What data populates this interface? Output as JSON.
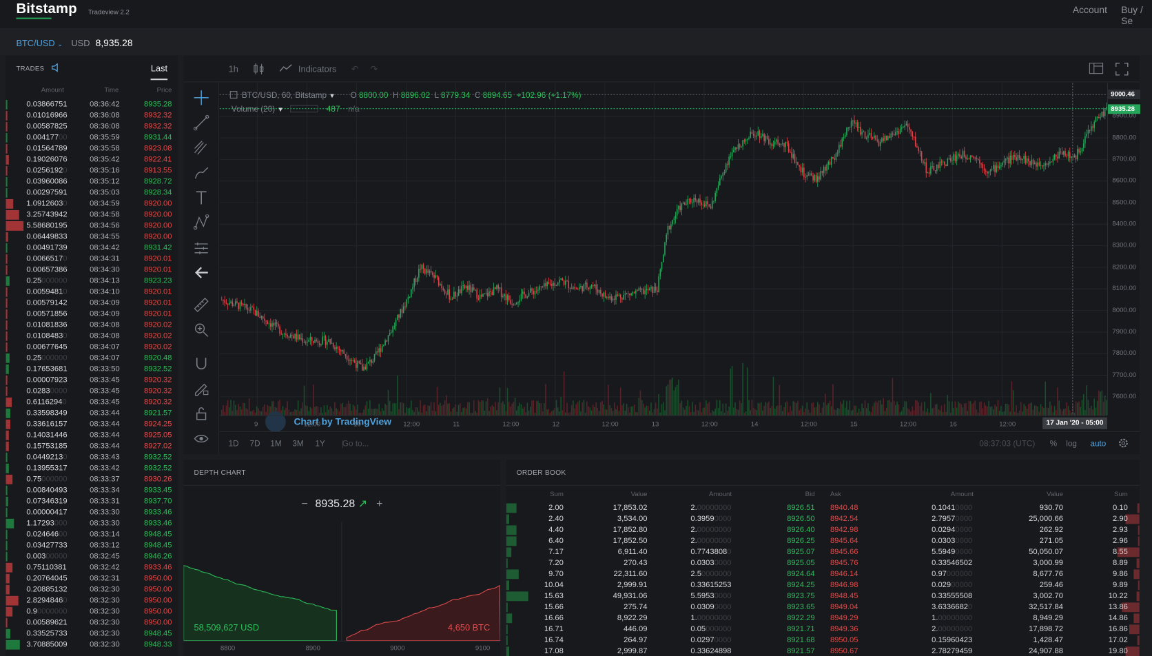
{
  "header": {
    "logo": "Bitstamp",
    "version": "Tradeview 2.2",
    "nav": [
      "Account",
      "Buy / Se"
    ]
  },
  "pair": {
    "name": "BTC/USD",
    "currency": "USD",
    "price": "8,935.28"
  },
  "trades": {
    "title": "TRADES",
    "tab": "Last",
    "columns": [
      "Amount",
      "Time",
      "Price"
    ],
    "rows": [
      [
        "0.03866751",
        "",
        "08:36:42",
        "8935.28",
        "up"
      ],
      [
        "0.01016966",
        "",
        "08:36:08",
        "8932.32",
        "dn"
      ],
      [
        "0.00587825",
        "",
        "08:36:08",
        "8932.32",
        "dn"
      ],
      [
        "0.004177",
        "00",
        "08:35:59",
        "8931.44",
        "up"
      ],
      [
        "0.01564789",
        "",
        "08:35:58",
        "8923.08",
        "dn"
      ],
      [
        "0.19026076",
        "",
        "08:35:42",
        "8922.41",
        "dn"
      ],
      [
        "0.0256192",
        "0",
        "08:35:16",
        "8913.55",
        "dn"
      ],
      [
        "0.03960086",
        "",
        "08:35:12",
        "8928.72",
        "up"
      ],
      [
        "0.00297591",
        "",
        "08:35:03",
        "8928.34",
        "up"
      ],
      [
        "1.0912603",
        "0",
        "08:34:59",
        "8920.00",
        "dn"
      ],
      [
        "3.25743942",
        "",
        "08:34:58",
        "8920.00",
        "dn"
      ],
      [
        "5.58680195",
        "",
        "08:34:56",
        "8920.00",
        "dn"
      ],
      [
        "0.06449833",
        "",
        "08:34:55",
        "8920.00",
        "dn"
      ],
      [
        "0.00491739",
        "",
        "08:34:42",
        "8931.42",
        "up"
      ],
      [
        "0.0066517",
        "0",
        "08:34:31",
        "8920.01",
        "dn"
      ],
      [
        "0.00657386",
        "",
        "08:34:30",
        "8920.01",
        "dn"
      ],
      [
        "0.25",
        "000000",
        "08:34:13",
        "8923.23",
        "up"
      ],
      [
        "0.0059481",
        "0",
        "08:34:10",
        "8920.01",
        "dn"
      ],
      [
        "0.00579142",
        "",
        "08:34:09",
        "8920.01",
        "dn"
      ],
      [
        "0.00571856",
        "",
        "08:34:09",
        "8920.01",
        "dn"
      ],
      [
        "0.01081836",
        "",
        "08:34:08",
        "8920.02",
        "dn"
      ],
      [
        "0.0108483",
        "0",
        "08:34:08",
        "8920.02",
        "dn"
      ],
      [
        "0.00677645",
        "",
        "08:34:07",
        "8920.02",
        "dn"
      ],
      [
        "0.25",
        "000000",
        "08:34:07",
        "8920.48",
        "up"
      ],
      [
        "0.17653681",
        "",
        "08:33:50",
        "8932.52",
        "up"
      ],
      [
        "0.00007923",
        "",
        "08:33:45",
        "8920.32",
        "dn"
      ],
      [
        "0.0283",
        "0000",
        "08:33:45",
        "8920.32",
        "dn"
      ],
      [
        "0.6116294",
        "0",
        "08:33:45",
        "8920.32",
        "dn"
      ],
      [
        "0.33598349",
        "",
        "08:33:44",
        "8921.57",
        "up"
      ],
      [
        "0.33616157",
        "",
        "08:33:44",
        "8924.25",
        "dn"
      ],
      [
        "0.14031446",
        "",
        "08:33:44",
        "8925.05",
        "dn"
      ],
      [
        "0.15753185",
        "",
        "08:33:44",
        "8927.02",
        "dn"
      ],
      [
        "0.0449213",
        "0",
        "08:33:43",
        "8932.52",
        "up"
      ],
      [
        "0.13955317",
        "",
        "08:33:42",
        "8932.52",
        "up"
      ],
      [
        "0.75",
        "000000",
        "08:33:37",
        "8930.26",
        "dn"
      ],
      [
        "0.00840493",
        "",
        "08:33:34",
        "8933.45",
        "up"
      ],
      [
        "0.07346319",
        "",
        "08:33:31",
        "8937.70",
        "up"
      ],
      [
        "0.00000417",
        "",
        "08:33:30",
        "8933.46",
        "up"
      ],
      [
        "1.17293",
        "000",
        "08:33:30",
        "8933.46",
        "up"
      ],
      [
        "0.024646",
        "00",
        "08:33:14",
        "8948.45",
        "up"
      ],
      [
        "0.03427733",
        "",
        "08:33:12",
        "8948.45",
        "up"
      ],
      [
        "0.003",
        "00000",
        "08:32:45",
        "8946.26",
        "up"
      ],
      [
        "0.75110381",
        "",
        "08:32:42",
        "8933.46",
        "dn"
      ],
      [
        "0.20764045",
        "",
        "08:32:31",
        "8950.00",
        "dn"
      ],
      [
        "0.20885132",
        "",
        "08:32:30",
        "8950.00",
        "dn"
      ],
      [
        "2.8294846",
        "0",
        "08:32:30",
        "8950.00",
        "dn"
      ],
      [
        "0.9",
        "0000000",
        "08:32:30",
        "8950.00",
        "dn"
      ],
      [
        "0.00589621",
        "",
        "08:32:30",
        "8950.00",
        "dn"
      ],
      [
        "0.33525733",
        "",
        "08:32:30",
        "8948.45",
        "up"
      ],
      [
        "3.70885009",
        "",
        "08:32:30",
        "8948.33",
        "up"
      ]
    ]
  },
  "chart": {
    "interval": "1h",
    "indicators": "Indicators",
    "symbol": "BTC/USD, 60, Bitstamp",
    "ohlc": {
      "o": "8800.00",
      "h": "8896.02",
      "l": "8779.34",
      "c": "8894.65",
      "chg": "+102.96 (+1.17%)"
    },
    "volume": {
      "label": "Volume (20)",
      "value": "487",
      "na": "n/a"
    },
    "watermark": "Chart by TradingView",
    "price_ticks": [
      "8900.00",
      "8800.00",
      "8700.00",
      "8600.00",
      "8500.00",
      "8400.00",
      "8300.00",
      "8200.00",
      "8100.00",
      "8000.00",
      "7900.00",
      "7800.00",
      "7700.00",
      "7600.00"
    ],
    "price_tag_high": "9000.46",
    "price_tag_last": "8935.28",
    "time_ticks": [
      "9",
      "12:00",
      "10",
      "12:00",
      "11",
      "12:00",
      "12",
      "12:00",
      "13",
      "12:00",
      "14",
      "12:00",
      "15",
      "12:00",
      "16",
      "12:00"
    ],
    "time_tag": "17 Jan '20 - 05:00",
    "ranges": [
      "1D",
      "7D",
      "1M",
      "3M",
      "1Y"
    ],
    "goto": "Go to...",
    "clock": "08:37:03 (UTC)",
    "pct": "%",
    "log": "log",
    "auto": "auto",
    "colors": {
      "up": "#26a65b",
      "down": "#e0424b"
    }
  },
  "depth": {
    "title": "DEPTH CHART",
    "mid": "8935.28",
    "bid_total": "58,509,627 USD",
    "ask_total": "4,650 BTC",
    "ticks": [
      "8800",
      "8900",
      "9000",
      "9100"
    ]
  },
  "orderbook": {
    "title": "ORDER BOOK",
    "columns": [
      "Sum",
      "Value",
      "Amount",
      "Bid",
      "Ask",
      "Amount",
      "Value",
      "Sum"
    ],
    "rows": [
      [
        "2.00",
        "17,853.02",
        "2.",
        "00000000",
        "8926.51",
        "8940.48",
        "0.1041",
        "0000",
        "930.70",
        "0.10"
      ],
      [
        "2.40",
        "3,534.00",
        "0.3959",
        "0000",
        "8926.50",
        "8942.54",
        "2.7957",
        "0000",
        "25,000.66",
        "2.90"
      ],
      [
        "4.40",
        "17,852.80",
        "2.",
        "00000000",
        "8926.40",
        "8942.98",
        "0.0294",
        "0000",
        "262.92",
        "2.93"
      ],
      [
        "6.40",
        "17,852.50",
        "2.",
        "00000000",
        "8926.25",
        "8945.64",
        "0.0303",
        "0000",
        "271.05",
        "2.96"
      ],
      [
        "7.17",
        "6,911.40",
        "0.7743808",
        "0",
        "8925.07",
        "8945.66",
        "5.5949",
        "0000",
        "50,050.07",
        "8.55"
      ],
      [
        "7.20",
        "270.43",
        "0.0303",
        "0000",
        "8925.05",
        "8945.76",
        "0.33546502",
        "",
        "3,000.99",
        "8.89"
      ],
      [
        "9.70",
        "22,311.60",
        "2.5",
        "0000000",
        "8924.64",
        "8946.14",
        "0.97",
        "000000",
        "8,677.76",
        "9.86"
      ],
      [
        "10.04",
        "2,999.91",
        "0.33615253",
        "",
        "8924.25",
        "8946.98",
        "0.029",
        "00000",
        "259.46",
        "9.89"
      ],
      [
        "15.63",
        "49,931.06",
        "5.5953",
        "0000",
        "8923.75",
        "8948.45",
        "0.33555508",
        "",
        "3,002.70",
        "10.22"
      ],
      [
        "15.66",
        "275.74",
        "0.0309",
        "0000",
        "8923.65",
        "8949.04",
        "3.6336682",
        "0",
        "32,517.84",
        "13.86"
      ],
      [
        "16.66",
        "8,922.29",
        "1.",
        "00000000",
        "8922.29",
        "8949.29",
        "1.",
        "00000000",
        "8,949.29",
        "14.86"
      ],
      [
        "16.71",
        "446.09",
        "0.05",
        "000000",
        "8921.71",
        "8949.36",
        "2.",
        "00000000",
        "17,898.72",
        "16.86"
      ],
      [
        "16.74",
        "264.97",
        "0.0297",
        "0000",
        "8921.68",
        "8950.05",
        "0.15960423",
        "",
        "1,428.47",
        "17.02"
      ],
      [
        "17.08",
        "2,999.87",
        "0.33624898",
        "",
        "8921.57",
        "8950.67",
        "2.78279459",
        "",
        "24,907.88",
        "19.80"
      ]
    ]
  }
}
